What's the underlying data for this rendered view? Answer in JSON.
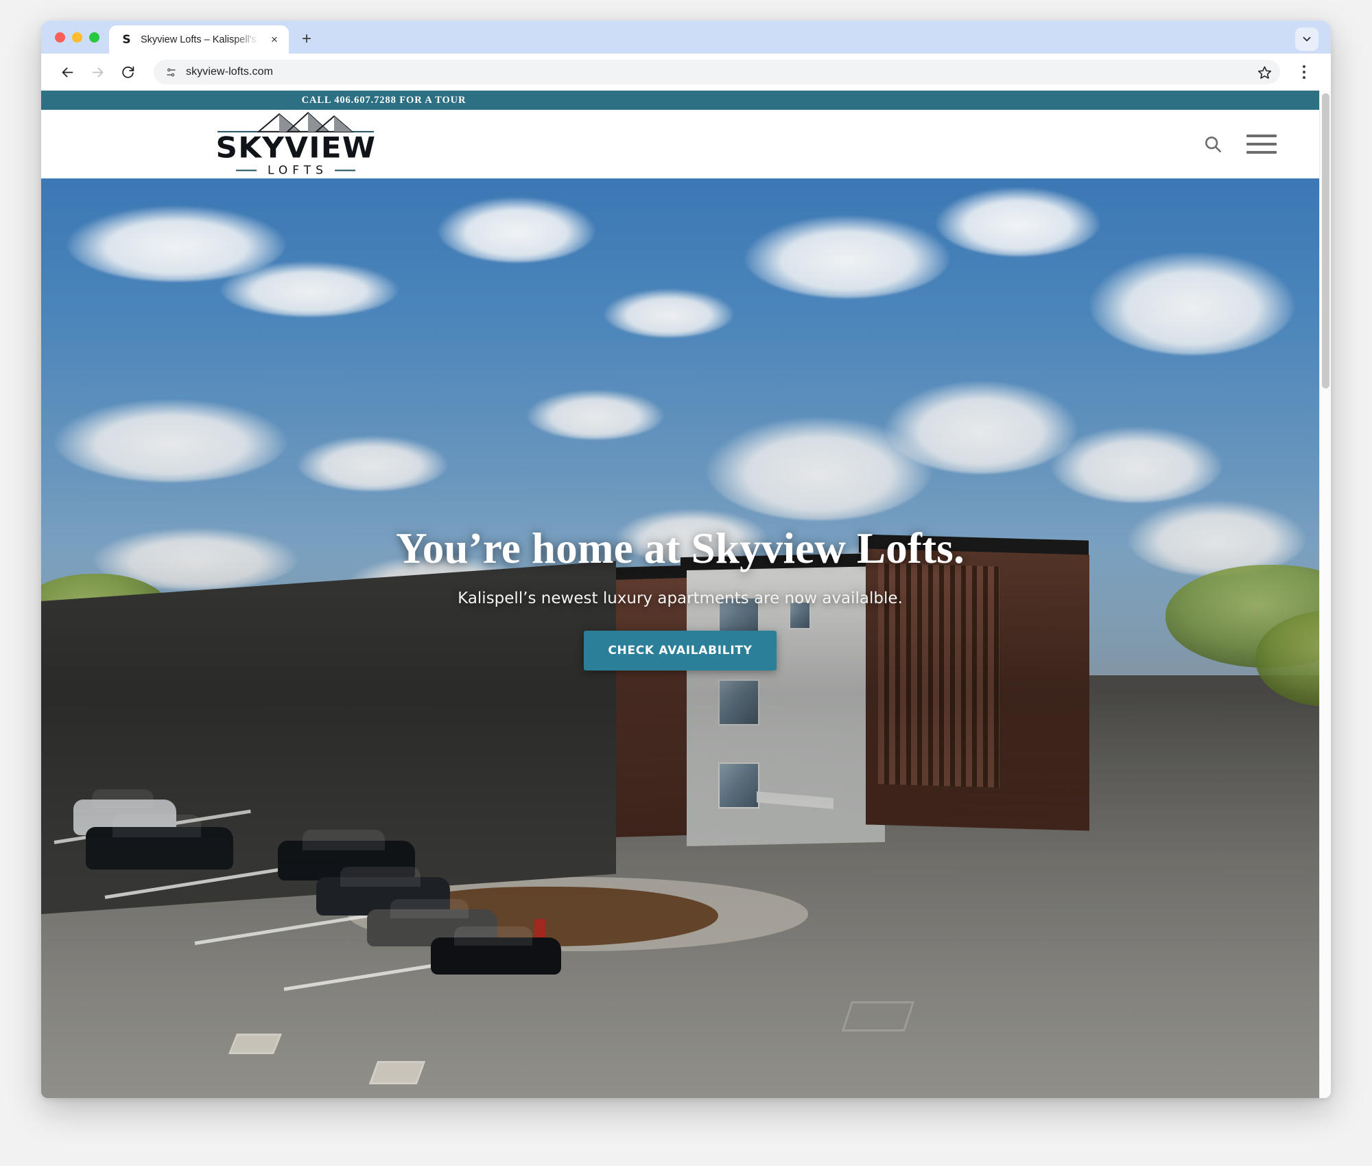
{
  "browser": {
    "tab": {
      "favicon_letter": "S",
      "title": "Skyview Lofts – Kalispell's Ne",
      "close_label": "×"
    },
    "new_tab_label": "+",
    "toolbar": {
      "back_icon": "back-arrow-icon",
      "forward_icon": "forward-arrow-icon",
      "reload_icon": "reload-icon",
      "site_info_icon": "site-settings-icon",
      "url": "skyview-lofts.com",
      "bookmark_icon": "star-icon",
      "menu_icon": "three-dot-menu-icon"
    },
    "tab_search_icon": "chevron-down-icon"
  },
  "site": {
    "announcement": "CALL 406.607.7288 FOR A TOUR",
    "logo": {
      "word": "SKYVIEW",
      "sub": "LOFTS"
    },
    "header": {
      "search_icon": "search-icon",
      "menu_icon": "hamburger-menu-icon"
    },
    "hero": {
      "title": "You’re home at Skyview Lofts.",
      "subtitle": "Kalispell’s newest luxury apartments are now availalble.",
      "cta_label": "CHECK AVAILABILITY"
    }
  },
  "colors": {
    "teal": "#2d7083",
    "cta_teal": "#2b7f99",
    "tabstrip": "#cddcf7",
    "omnibox": "#f1f3f4"
  }
}
